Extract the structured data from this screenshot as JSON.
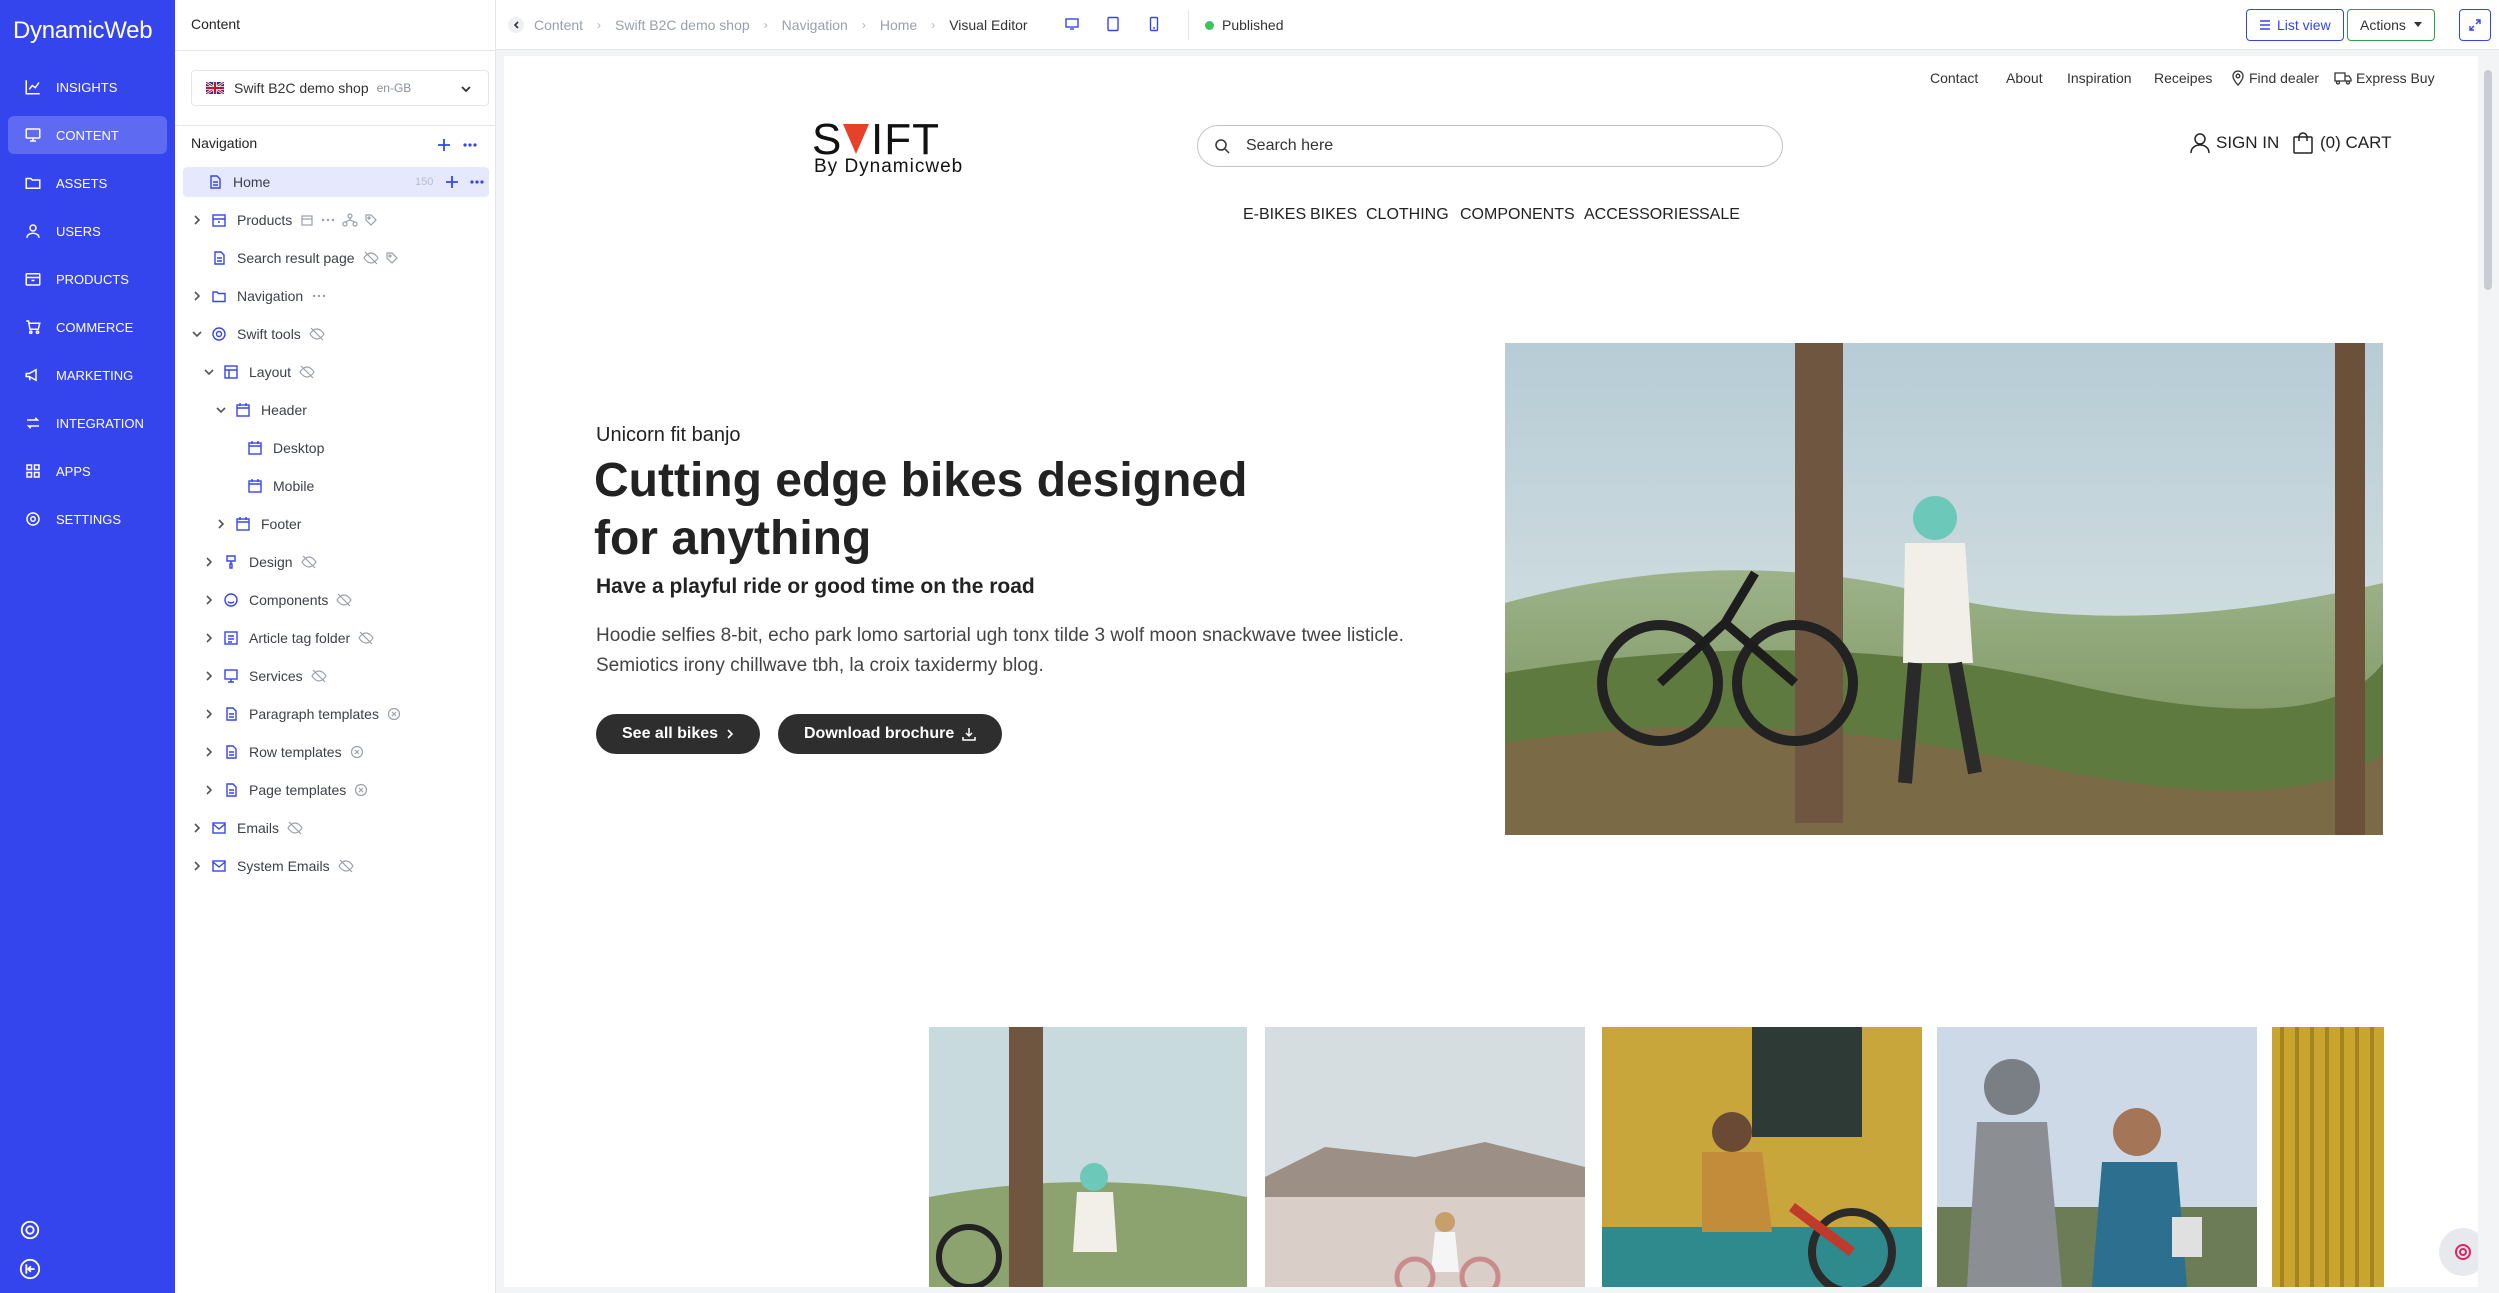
{
  "leftnav": {
    "brand": "DynamicWeb",
    "items": [
      {
        "label": "INSIGHTS",
        "icon": "chart-line-icon"
      },
      {
        "label": "CONTENT",
        "icon": "monitor-icon"
      },
      {
        "label": "ASSETS",
        "icon": "folder-icon"
      },
      {
        "label": "USERS",
        "icon": "user-icon"
      },
      {
        "label": "PRODUCTS",
        "icon": "box-icon"
      },
      {
        "label": "COMMERCE",
        "icon": "cart-icon"
      },
      {
        "label": "MARKETING",
        "icon": "megaphone-icon"
      },
      {
        "label": "INTEGRATION",
        "icon": "arrows-icon"
      },
      {
        "label": "APPS",
        "icon": "grid-icon"
      },
      {
        "label": "SETTINGS",
        "icon": "gear-icon"
      }
    ],
    "active_index": 1
  },
  "tree": {
    "title": "Content",
    "site": {
      "name": "Swift B2C demo shop",
      "lang": "en-GB"
    },
    "nav_heading": "Navigation",
    "nodes": [
      {
        "label": "Home",
        "badge": "150"
      },
      {
        "label": "Products"
      },
      {
        "label": "Search result page"
      },
      {
        "label": "Navigation"
      },
      {
        "label": "Swift tools"
      },
      {
        "label": "Layout"
      },
      {
        "label": "Header"
      },
      {
        "label": "Desktop"
      },
      {
        "label": "Mobile"
      },
      {
        "label": "Footer"
      },
      {
        "label": "Design"
      },
      {
        "label": "Components"
      },
      {
        "label": "Article tag folder"
      },
      {
        "label": "Services"
      },
      {
        "label": "Paragraph templates"
      },
      {
        "label": "Row templates"
      },
      {
        "label": "Page templates"
      },
      {
        "label": "Emails"
      },
      {
        "label": "System Emails"
      }
    ]
  },
  "topbar": {
    "breadcrumbs": [
      "Content",
      "Swift B2C demo shop",
      "Navigation",
      "Home",
      "Visual Editor"
    ],
    "status": "Published",
    "list_view": "List view",
    "actions": "Actions"
  },
  "site": {
    "util_links": [
      "Contact",
      "About",
      "Inspiration",
      "Receipes",
      "Find dealer",
      "Express Buy"
    ],
    "logo": {
      "main": "SWIFT",
      "sub": "By Dynamicweb"
    },
    "search_placeholder": "Search here",
    "sign_in": "SIGN IN",
    "cart": "(0) CART",
    "menu": [
      "E-BIKES",
      "BIKES",
      "CLOTHING",
      "COMPONENTS",
      "ACCESSORIES",
      "SALE"
    ],
    "hero": {
      "eyebrow": "Unicorn fit banjo",
      "title": "Cutting edge bikes designed for anything",
      "subtitle": "Have a playful ride or good time on the road",
      "body": "Hoodie selfies 8-bit, echo park lomo sartorial ugh tonx tilde 3 wolf moon snackwave twee listicle. Semiotics irony chillwave tbh, la croix taxidermy blog.",
      "btn_primary": "See all bikes",
      "btn_secondary": "Download brochure"
    }
  },
  "colors": {
    "brand": "#3545ee",
    "published": "#3cc45a",
    "logo_accent": "#e8412b"
  }
}
